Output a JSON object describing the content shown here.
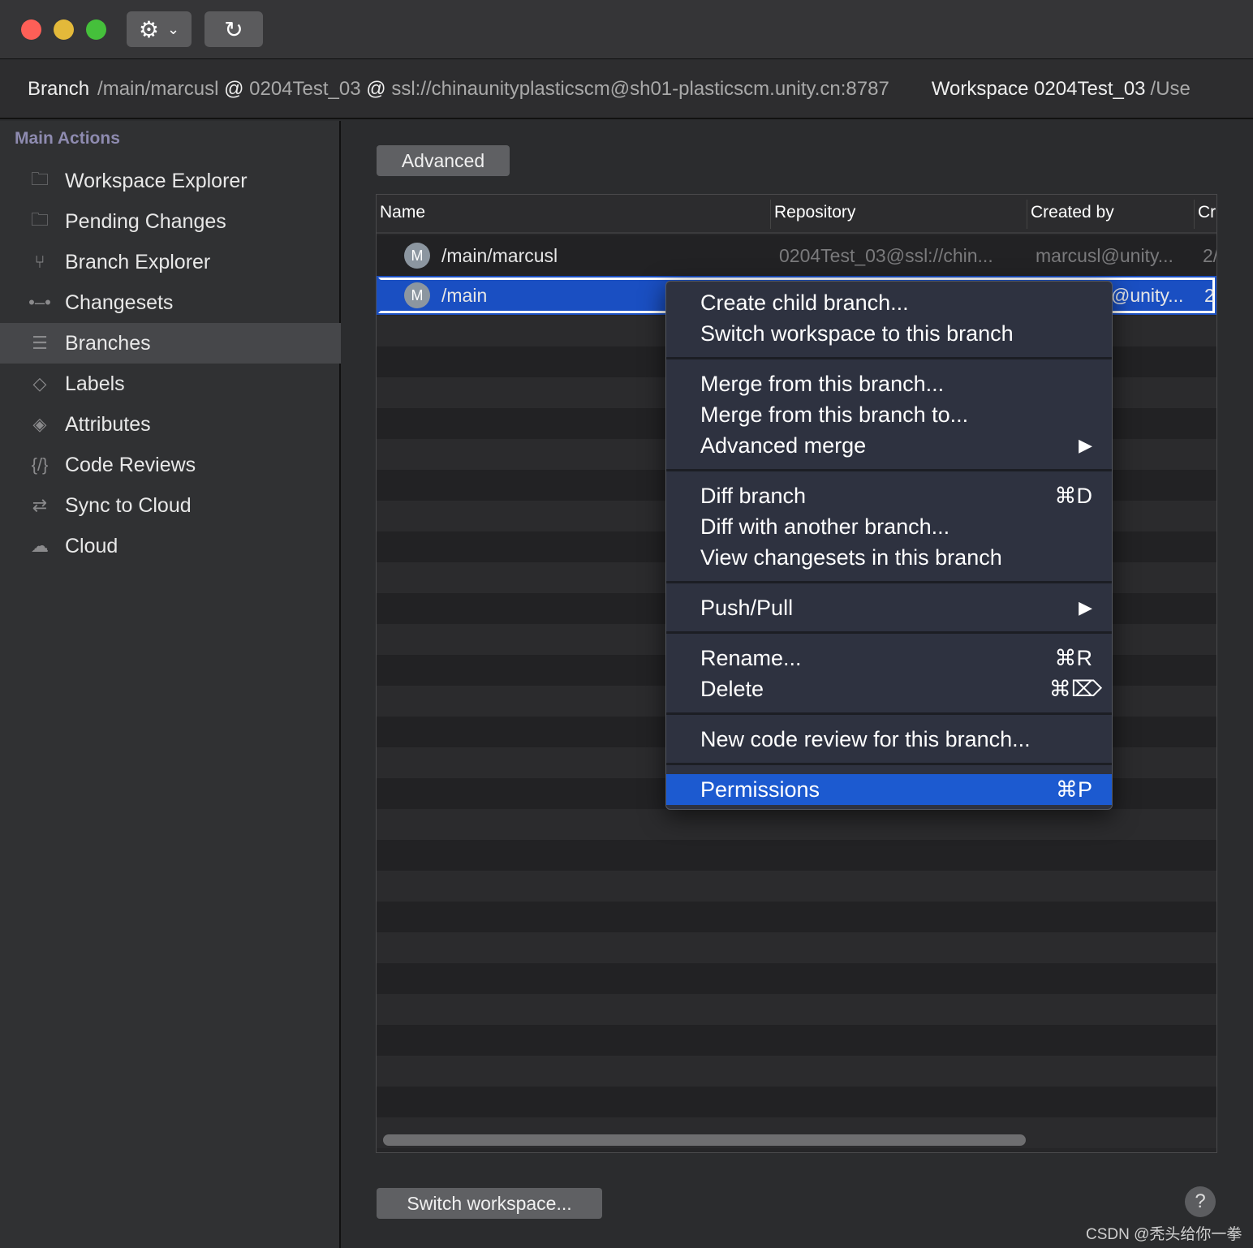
{
  "toolbar": {
    "settings_icon": "gear-icon",
    "refresh_icon": "refresh-icon"
  },
  "info": {
    "branch_label": "Branch",
    "branch": "/main/marcusl",
    "at1": "@",
    "workspace_name": "0204Test_03",
    "at2": "@",
    "server": "ssl://chinaunityplasticscm@sh01-plasticscm.unity.cn:8787",
    "workspace_label": "Workspace 0204Test_03",
    "workspace_path": "/Use"
  },
  "sidebar": {
    "heading": "Main Actions",
    "items": [
      {
        "label": "Workspace Explorer",
        "icon": "folder-icon"
      },
      {
        "label": "Pending Changes",
        "icon": "pending-changes-icon"
      },
      {
        "label": "Branch Explorer",
        "icon": "branch-explorer-icon"
      },
      {
        "label": "Changesets",
        "icon": "changesets-icon"
      },
      {
        "label": "Branches",
        "icon": "list-icon",
        "active": true
      },
      {
        "label": "Labels",
        "icon": "tag-icon"
      },
      {
        "label": "Attributes",
        "icon": "attribute-tag-icon"
      },
      {
        "label": "Code Reviews",
        "icon": "code-icon"
      },
      {
        "label": "Sync to Cloud",
        "icon": "sync-icon"
      },
      {
        "label": "Cloud",
        "icon": "cloud-icon"
      }
    ]
  },
  "main": {
    "advanced_label": "Advanced",
    "switch_label": "Switch workspace...",
    "help": "?"
  },
  "table": {
    "columns": [
      "Name",
      "Repository",
      "Created by",
      "Cr"
    ],
    "rows": [
      {
        "avatar": "M",
        "name": "/main/marcusl",
        "repository": "0204Test_03@ssl://chin...",
        "created_by": "marcusl@unity...",
        "created": "2/"
      },
      {
        "avatar": "M",
        "name": "/main",
        "repository": "",
        "created_by": "@unity...",
        "created": "2",
        "selected": true
      }
    ]
  },
  "menu": {
    "items": [
      {
        "label": "Create child branch..."
      },
      {
        "label": "Switch workspace to this branch"
      },
      {
        "label": "Merge from this branch..."
      },
      {
        "label": "Merge from this branch to..."
      },
      {
        "label": "Advanced merge",
        "submenu": "▶"
      },
      {
        "label": "Diff branch",
        "shortcut": "⌘D"
      },
      {
        "label": "Diff with another branch..."
      },
      {
        "label": "View changesets in this branch"
      },
      {
        "label": "Push/Pull",
        "submenu": "▶"
      },
      {
        "label": "Rename...",
        "shortcut": "⌘R"
      },
      {
        "label": "Delete",
        "shortcut": "⌘⌦"
      },
      {
        "label": "New code review for this branch..."
      },
      {
        "label": "Permissions",
        "shortcut": "⌘P",
        "highlighted": true
      }
    ]
  },
  "watermark": "CSDN @秃头给你一拳",
  "colors": {
    "selection": "#1a4fc2",
    "menu_highlight": "#1c5ad0",
    "close": "#fe5f57",
    "minimize": "#e3b93a",
    "zoom": "#45c03b"
  }
}
